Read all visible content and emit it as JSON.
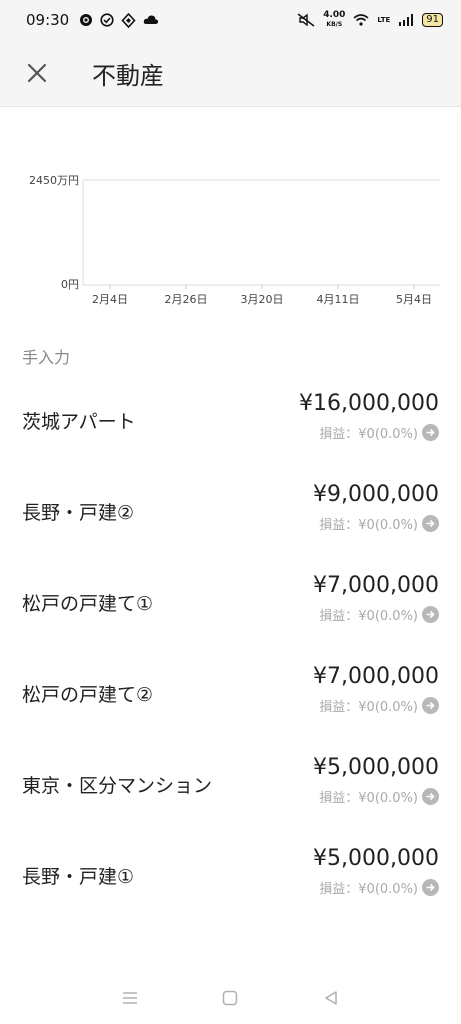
{
  "status": {
    "time": "09:30",
    "net_speed_value": "4.00",
    "net_speed_unit": "KB/S",
    "battery": "91",
    "lte": "LTE"
  },
  "header": {
    "title": "不動産",
    "close_icon": "close-icon"
  },
  "chart_data": {
    "type": "line",
    "x_tick_labels": [
      "2月4日",
      "2月26日",
      "3月20日",
      "4月11日",
      "5月4日"
    ],
    "y_tick_labels": [
      "2450万円",
      "0円"
    ],
    "series": []
  },
  "section": {
    "label": "手入力"
  },
  "assets": [
    {
      "name": "茨城アパート",
      "value": "¥16,000,000",
      "pl": "損益：¥0(0.0%)"
    },
    {
      "name": "長野・戸建②",
      "value": "¥9,000,000",
      "pl": "損益：¥0(0.0%)"
    },
    {
      "name": "松戸の戸建て①",
      "value": "¥7,000,000",
      "pl": "損益：¥0(0.0%)"
    },
    {
      "name": "松戸の戸建て②",
      "value": "¥7,000,000",
      "pl": "損益：¥0(0.0%)"
    },
    {
      "name": "東京・区分マンション",
      "value": "¥5,000,000",
      "pl": "損益：¥0(0.0%)"
    },
    {
      "name": "長野・戸建①",
      "value": "¥5,000,000",
      "pl": "損益：¥0(0.0%)"
    }
  ],
  "nav": {
    "menu_icon": "menu-icon",
    "home_icon": "home-icon",
    "back_icon": "back-icon"
  },
  "colors": {
    "header_bg": "#f5f5f5",
    "muted_text": "#aaaaaa",
    "arrow_bg": "#b8b8b8"
  }
}
